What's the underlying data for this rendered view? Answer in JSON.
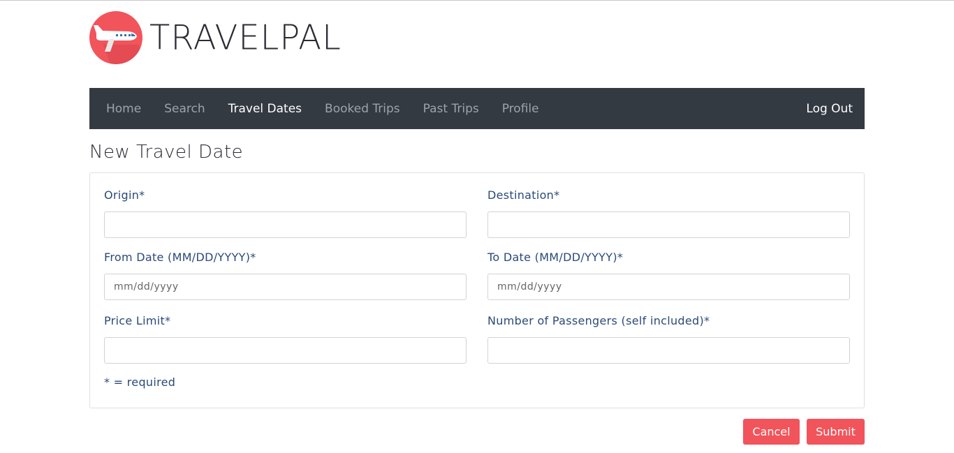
{
  "brand": {
    "name": "TRAVELPAL",
    "logo_icon": "airplane-icon",
    "logo_color": "#f2545b"
  },
  "nav": {
    "items": [
      {
        "label": "Home",
        "active": false
      },
      {
        "label": "Search",
        "active": false
      },
      {
        "label": "Travel Dates",
        "active": true
      },
      {
        "label": "Booked Trips",
        "active": false
      },
      {
        "label": "Past Trips",
        "active": false
      },
      {
        "label": "Profile",
        "active": false
      }
    ],
    "logout_label": "Log Out"
  },
  "page": {
    "title": "New Travel Date"
  },
  "form": {
    "origin": {
      "label": "Origin*",
      "value": "",
      "placeholder": ""
    },
    "destination": {
      "label": "Destination*",
      "value": "",
      "placeholder": ""
    },
    "from_date": {
      "label": "From Date (MM/DD/YYYY)*",
      "value": "",
      "placeholder": "mm/dd/yyyy"
    },
    "to_date": {
      "label": "To Date (MM/DD/YYYY)*",
      "value": "",
      "placeholder": "mm/dd/yyyy"
    },
    "price_limit": {
      "label": "Price Limit*",
      "value": "",
      "placeholder": ""
    },
    "passengers": {
      "label": "Number of Passengers (self included)*",
      "value": "",
      "placeholder": ""
    },
    "required_note": "* = required"
  },
  "actions": {
    "cancel_label": "Cancel",
    "submit_label": "Submit",
    "button_color": "#f2545b"
  },
  "colors": {
    "navbar": "#343a42",
    "label": "#2a4a78"
  }
}
